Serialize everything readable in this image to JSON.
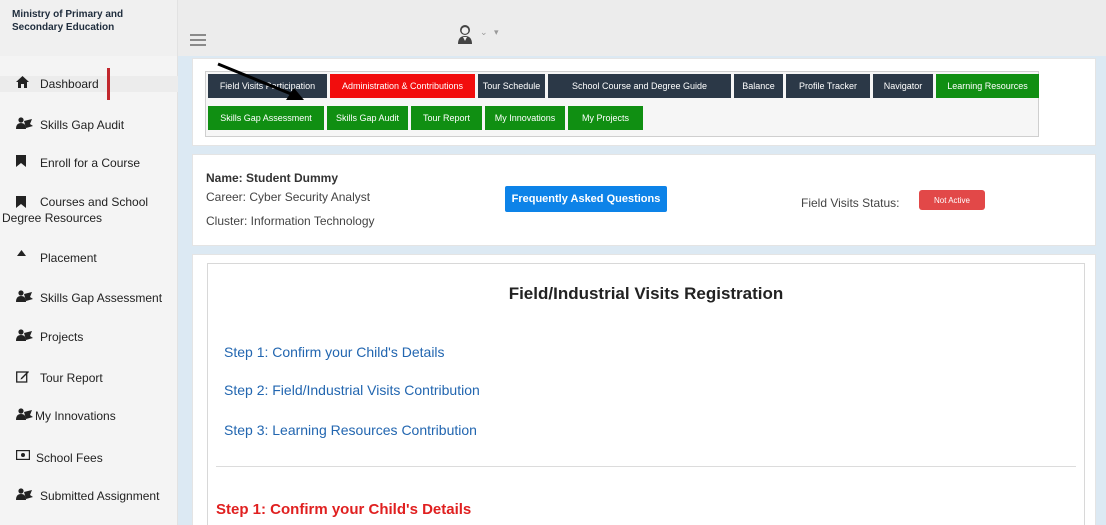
{
  "brand": {
    "line1": "Ministry of Primary and",
    "line2": "Secondary Education"
  },
  "sidebar": {
    "items": [
      {
        "label": "Dashboard",
        "icon": "home-icon"
      },
      {
        "label": "Skills Gap Audit",
        "icon": "users-icon"
      },
      {
        "label": "Enroll for a Course",
        "icon": "bookmark-icon"
      },
      {
        "label": "Courses and School",
        "label2": "Degree Resources",
        "icon": "bookmark-icon"
      },
      {
        "label": "Placement",
        "icon": "caret-up-icon"
      },
      {
        "label": "Skills Gap Assessment",
        "icon": "users-icon"
      },
      {
        "label": "Projects",
        "icon": "users-icon"
      },
      {
        "label": "Tour Report",
        "icon": "edit-icon"
      },
      {
        "label": "My Innovations",
        "icon": "users-icon"
      },
      {
        "label": "School Fees",
        "icon": "money-icon"
      },
      {
        "label": "Submitted Assignment",
        "icon": "users-icon"
      }
    ]
  },
  "nav": {
    "row1": [
      "Field Visits Participation",
      "Administration & Contributions",
      "Tour Schedule",
      "School Course and Degree Guide",
      "Balance",
      "Profile Tracker",
      "Navigator",
      "Learning Resources"
    ],
    "row2": [
      "Skills Gap Assessment",
      "Skills Gap Audit",
      "Tour Report",
      "My Innovations",
      "My Projects"
    ]
  },
  "profile": {
    "name": "Name: Student Dummy",
    "career": "Career: Cyber Security Analyst",
    "cluster": "Cluster: Information Technology",
    "faq_label": "Frequently Asked Questions",
    "field_visits_label": "Field Visits Status:",
    "status": "Not Active"
  },
  "registration": {
    "title": "Field/Industrial Visits Registration",
    "steps": [
      "Step 1: Confirm your Child's Details",
      "Step 2: Field/Industrial Visits Contribution",
      "Step 3: Learning Resources Contribution"
    ],
    "current_step_heading": "Step 1: Confirm your Child's Details"
  },
  "colors": {
    "dark_button": "#2b3847",
    "red_button": "#f20d0d",
    "green_button": "#108f12",
    "faq_button": "#0d83e8",
    "status_badge": "#e24848",
    "step_link": "#2266b0",
    "step_heading": "#e02020"
  }
}
